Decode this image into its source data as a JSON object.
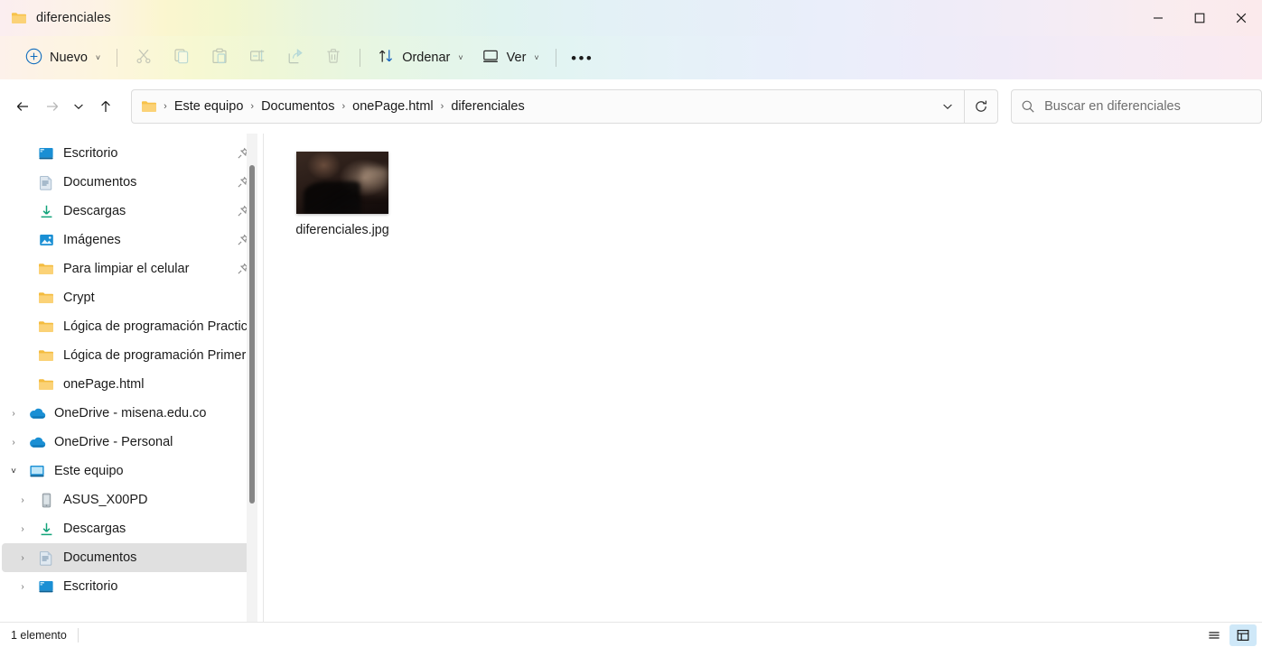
{
  "window": {
    "title": "diferenciales",
    "folder_icon": "folder-icon",
    "controls": {
      "minimize": "—",
      "maximize": "☐",
      "close": "✕"
    }
  },
  "toolbar": {
    "new_label": "Nuevo",
    "new_icon": "plus-circle-icon",
    "items": [
      {
        "name": "cut",
        "icon": "scissors-icon",
        "disabled": true
      },
      {
        "name": "copy",
        "icon": "copy-icon",
        "disabled": true
      },
      {
        "name": "paste",
        "icon": "paste-icon",
        "disabled": true
      },
      {
        "name": "rename",
        "icon": "rename-icon",
        "disabled": true
      },
      {
        "name": "share",
        "icon": "share-icon",
        "disabled": true
      },
      {
        "name": "delete",
        "icon": "trash-icon",
        "disabled": true
      }
    ],
    "sort_label": "Ordenar",
    "sort_icon": "sort-arrows-icon",
    "view_label": "Ver",
    "view_icon": "monitor-icon",
    "more_label": "•••",
    "chevron": "˅"
  },
  "address": {
    "back_icon": "arrow-left-icon",
    "forward_icon": "arrow-right-icon",
    "recent_icon": "chevron-down-icon",
    "up_icon": "arrow-up-icon",
    "folder_icon": "folder-icon",
    "separator": "›",
    "breadcrumbs": [
      "Este equipo",
      "Documentos",
      "onePage.html",
      "diferenciales"
    ],
    "dropdown_icon": "chevron-down-icon",
    "refresh_icon": "refresh-icon"
  },
  "search": {
    "icon": "search-icon",
    "placeholder": "Buscar en diferenciales",
    "value": ""
  },
  "sidebar": {
    "items": [
      {
        "label": "Escritorio",
        "icon": "desktop-icon",
        "pinned": true,
        "expander": "",
        "indent": 1
      },
      {
        "label": "Documentos",
        "icon": "documents-icon",
        "pinned": true,
        "expander": "",
        "indent": 1
      },
      {
        "label": "Descargas",
        "icon": "downloads-icon",
        "pinned": true,
        "expander": "",
        "indent": 1
      },
      {
        "label": "Imágenes",
        "icon": "pictures-icon",
        "pinned": true,
        "expander": "",
        "indent": 1
      },
      {
        "label": "Para limpiar el celular",
        "icon": "folder-icon",
        "pinned": true,
        "expander": "",
        "indent": 1
      },
      {
        "label": "Crypt",
        "icon": "folder-icon",
        "pinned": false,
        "expander": "",
        "indent": 1
      },
      {
        "label": "Lógica de programación Practic",
        "icon": "folder-icon",
        "pinned": false,
        "expander": "",
        "indent": 1
      },
      {
        "label": "Lógica de programación Primer",
        "icon": "folder-icon",
        "pinned": false,
        "expander": "",
        "indent": 1
      },
      {
        "label": "onePage.html",
        "icon": "folder-icon",
        "pinned": false,
        "expander": "",
        "indent": 1
      },
      {
        "label": "OneDrive - misena.edu.co",
        "icon": "onedrive-icon",
        "pinned": false,
        "expander": "›",
        "indent": 0
      },
      {
        "label": "OneDrive - Personal",
        "icon": "onedrive-icon",
        "pinned": false,
        "expander": "›",
        "indent": 0
      },
      {
        "label": "Este equipo",
        "icon": "monitor-icon",
        "pinned": false,
        "expander": "˅",
        "indent": 0,
        "expanded": true
      },
      {
        "label": "ASUS_X00PD",
        "icon": "phone-icon",
        "pinned": false,
        "expander": "›",
        "indent": 1
      },
      {
        "label": "Descargas",
        "icon": "downloads-icon",
        "pinned": false,
        "expander": "›",
        "indent": 1
      },
      {
        "label": "Documentos",
        "icon": "documents-icon",
        "pinned": false,
        "expander": "›",
        "indent": 1,
        "selected": true
      },
      {
        "label": "Escritorio",
        "icon": "desktop-icon",
        "pinned": false,
        "expander": "›",
        "indent": 1
      }
    ],
    "pin_icon": "pin-icon"
  },
  "files": [
    {
      "name": "diferenciales.jpg",
      "icon": "image-thumbnail"
    }
  ],
  "statusbar": {
    "count_text": "1 elemento",
    "list_view_icon": "list-view-icon",
    "details_view_icon": "details-view-icon"
  },
  "colors": {
    "accent": "#0078d4",
    "selection": "#cfe8f8",
    "sidebar_selected": "#e0e0e0",
    "scrollbar_thumb": "#868686"
  }
}
